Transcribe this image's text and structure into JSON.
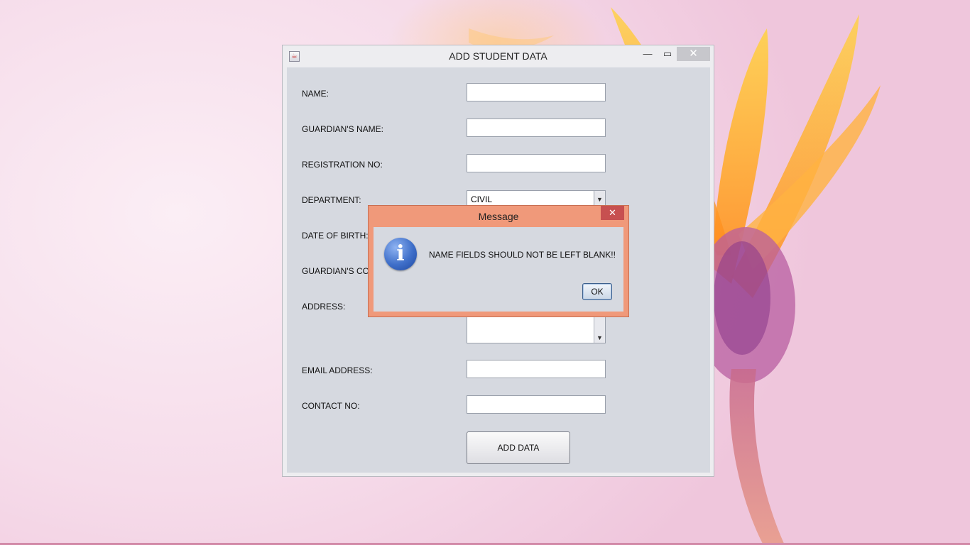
{
  "window": {
    "title": "ADD STUDENT DATA",
    "app_icon": "java-cup-icon",
    "controls": {
      "minimize": "—",
      "maximize": "▭",
      "close": "✕"
    }
  },
  "form": {
    "labels": {
      "name": "NAME:",
      "guardian_name": "GUARDIAN'S NAME:",
      "registration_no": "REGISTRATION NO:",
      "department": "DEPARTMENT:",
      "date_of_birth": "DATE OF BIRTH:",
      "guardian_contact": "GUARDIAN'S CO",
      "address": "ADDRESS:",
      "email_address": "EMAIL ADDRESS:",
      "contact_no": "CONTACT NO:"
    },
    "values": {
      "name": "",
      "guardian_name": "",
      "registration_no": "",
      "email_address": "",
      "contact_no": ""
    },
    "department_selected": "CIVIL",
    "add_button_label": "ADD DATA"
  },
  "dialog": {
    "title": "Message",
    "icon": "info-icon",
    "message": "NAME FIELDS SHOULD NOT BE LEFT BLANK!!",
    "ok_label": "OK",
    "close_glyph": "✕",
    "info_glyph": "i"
  },
  "colors": {
    "dialog_frame": "#f0997a",
    "dialog_close": "#c75050",
    "client_bg": "#d6d9e0"
  }
}
